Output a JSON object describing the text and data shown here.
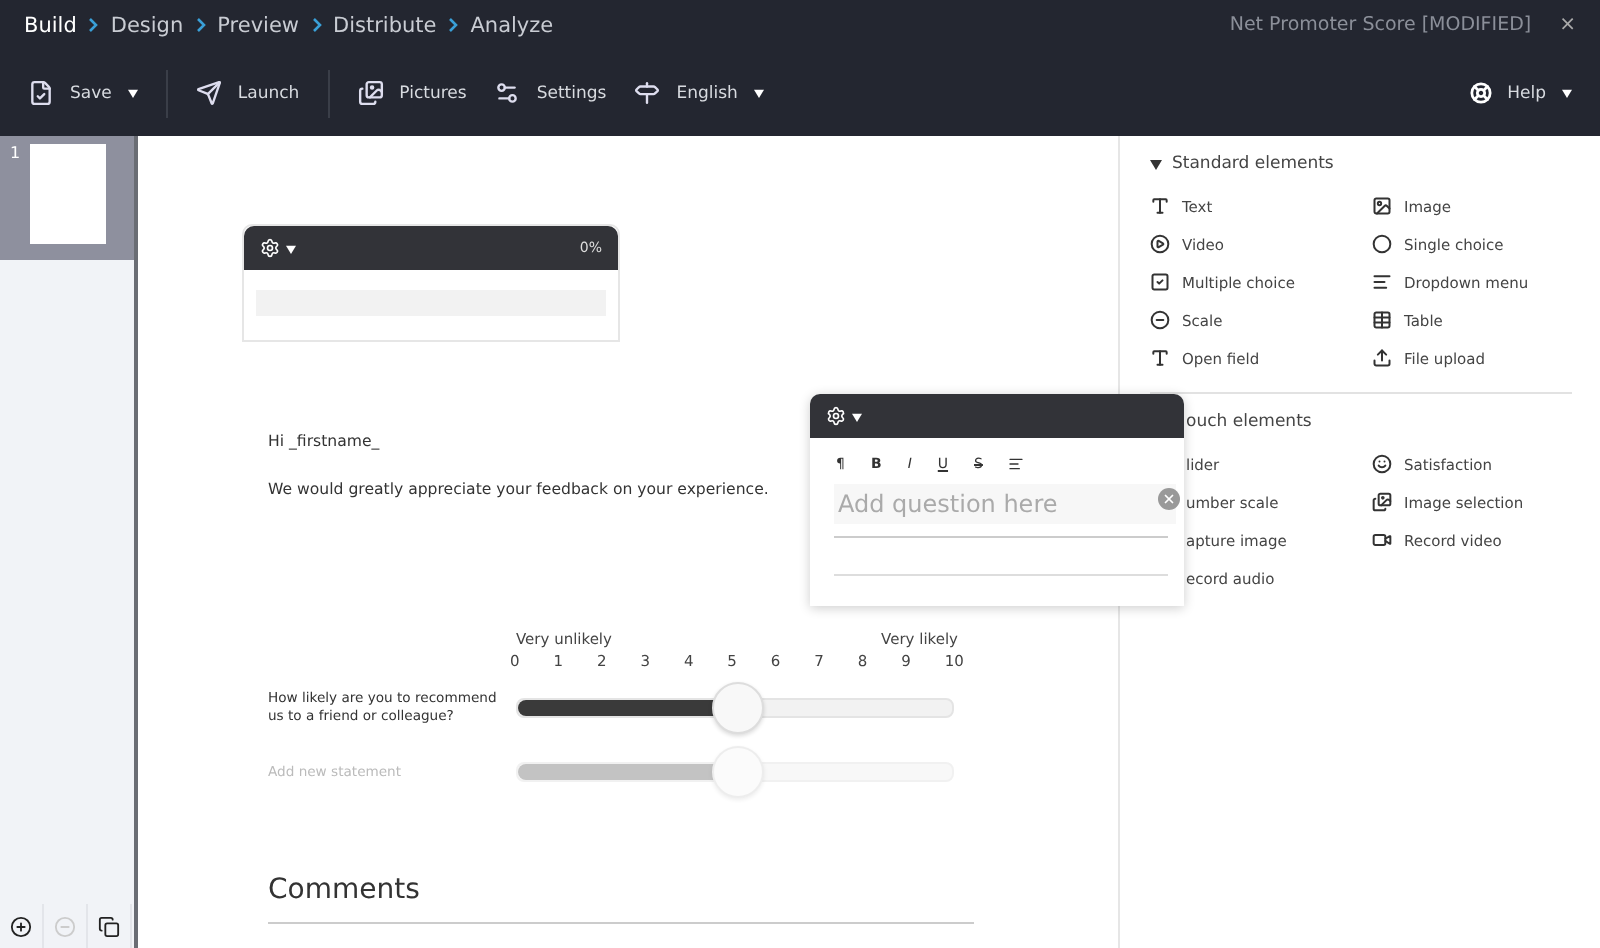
{
  "nav": {
    "steps": [
      {
        "label": "Build",
        "selected": true
      },
      {
        "label": "Design",
        "selected": false
      },
      {
        "label": "Preview",
        "selected": false
      },
      {
        "label": "Distribute",
        "selected": false
      },
      {
        "label": "Analyze",
        "selected": false
      }
    ],
    "title": "Net Promoter Score [MODIFIED]",
    "close": "×"
  },
  "toolbar": {
    "items": [
      {
        "kind": "save",
        "label": "Save",
        "menu": true
      },
      {
        "kind": "launch",
        "label": "Launch",
        "menu": false
      },
      {
        "kind": "pictures",
        "label": "Pictures",
        "menu": false
      },
      {
        "kind": "settings",
        "label": "Settings",
        "menu": false
      },
      {
        "kind": "language",
        "label": "English",
        "menu": true
      }
    ],
    "help": {
      "label": "Help"
    }
  },
  "pages": [
    {
      "number": "1",
      "selected": true
    }
  ],
  "progress": {
    "percent": "0%",
    "level": 0
  },
  "intro": {
    "greeting": "Hi _firstname_",
    "message": "We would greatly appreciate your feedback on your experience."
  },
  "scale": {
    "low_label": "Very unlikely",
    "high_label": "Very likely",
    "ticks": [
      "0",
      "1",
      "2",
      "3",
      "4",
      "5",
      "6",
      "7",
      "8",
      "9",
      "10"
    ],
    "rows": [
      {
        "label": "How likely are you to recommend us to a friend or colleague?",
        "level": 0.5,
        "disabled": false
      },
      {
        "label": "Add new statement",
        "level": 0.5,
        "disabled": true
      }
    ]
  },
  "comments": {
    "heading": "Comments"
  },
  "editor": {
    "format_buttons": [
      "¶",
      "B",
      "I",
      "U",
      "S"
    ],
    "placeholder": "Add question here"
  },
  "panel": {
    "sections": [
      {
        "title": "Standard elements",
        "expanded": true,
        "items": [
          {
            "kind": "text",
            "label": "Text"
          },
          {
            "kind": "image",
            "label": "Image"
          },
          {
            "kind": "video",
            "label": "Video"
          },
          {
            "kind": "single",
            "label": "Single choice"
          },
          {
            "kind": "multiple",
            "label": "Multiple choice"
          },
          {
            "kind": "dropdown",
            "label": "Dropdown menu"
          },
          {
            "kind": "scale",
            "label": "Scale"
          },
          {
            "kind": "table",
            "label": "Table"
          },
          {
            "kind": "openfield",
            "label": "Open field"
          },
          {
            "kind": "upload",
            "label": "File upload"
          }
        ]
      },
      {
        "title": "ouch elements",
        "expanded": true,
        "items": [
          {
            "kind": "none",
            "label": "lider"
          },
          {
            "kind": "satisfaction",
            "label": "Satisfaction"
          },
          {
            "kind": "none",
            "label": "umber scale"
          },
          {
            "kind": "imageselect",
            "label": "Image selection"
          },
          {
            "kind": "none",
            "label": "apture image"
          },
          {
            "kind": "video-rec",
            "label": "Record video"
          },
          {
            "kind": "none",
            "label": "ecord audio"
          }
        ]
      }
    ]
  }
}
